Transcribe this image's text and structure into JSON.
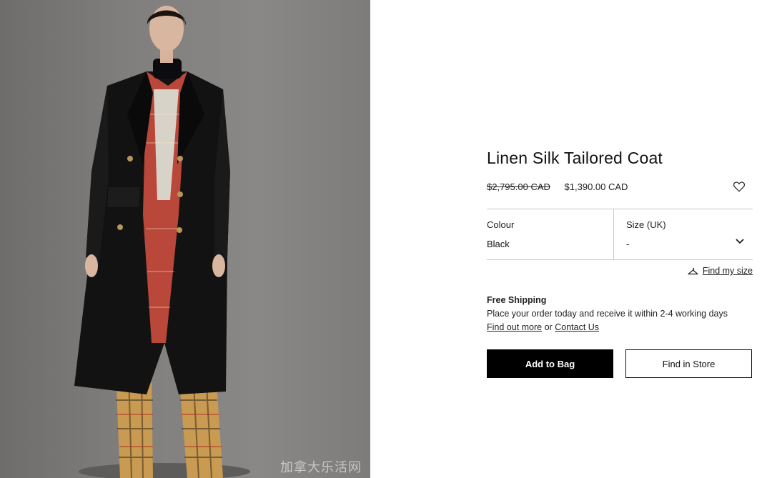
{
  "product": {
    "title": "Linen Silk Tailored Coat",
    "price_original": "$2,795.00 CAD",
    "price_sale": "$1,390.00 CAD"
  },
  "selectors": {
    "colour": {
      "label": "Colour",
      "value": "Black"
    },
    "size": {
      "label": "Size (UK)",
      "value": "-"
    }
  },
  "find_size": {
    "label": "Find my size"
  },
  "shipping": {
    "heading": "Free Shipping",
    "text": "Place your order today and receive it within 2-4 working days",
    "link_more": "Find out more",
    "or": "or",
    "link_contact": "Contact Us"
  },
  "buttons": {
    "add_to_bag": "Add to Bag",
    "find_in_store": "Find in Store"
  },
  "watermark": "加拿大乐活网",
  "icons": {
    "wishlist": "heart-icon",
    "size_guide": "hanger-icon",
    "size_dropdown": "chevron-down-icon"
  },
  "colors": {
    "button_primary_bg": "#000000",
    "divider": "#c9c9c9"
  }
}
